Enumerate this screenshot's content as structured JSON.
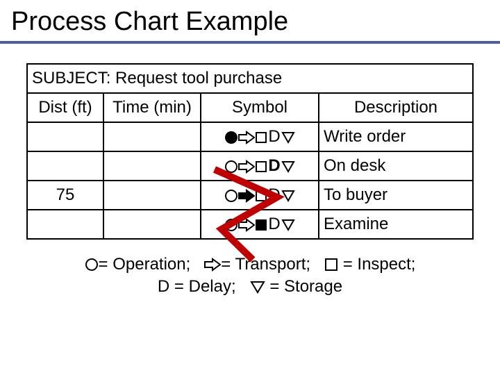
{
  "title": "Process Chart Example",
  "subject_label": "SUBJECT:",
  "subject_value": "Request tool purchase",
  "headers": {
    "dist": "Dist (ft)",
    "time": "Time (min)",
    "symbol": "Symbol",
    "description": "Description"
  },
  "rows": [
    {
      "dist": "",
      "time": "",
      "active": "operation",
      "description": "Write order"
    },
    {
      "dist": "",
      "time": "",
      "active": "delay",
      "description": "On desk"
    },
    {
      "dist": "75",
      "time": "",
      "active": "transport",
      "description": "To buyer"
    },
    {
      "dist": "",
      "time": "",
      "active": "inspect",
      "description": "Examine"
    }
  ],
  "legend": {
    "operation": "= Operation;",
    "transport": "= Transport;",
    "inspect": "= Inspect;",
    "delay_pre": "D",
    "delay": "= Delay;",
    "storage": "= Storage"
  },
  "chart_data": {
    "type": "table",
    "title": "Process Chart Example",
    "subject": "Request tool purchase",
    "columns": [
      "Dist (ft)",
      "Time (min)",
      "Symbol",
      "Description"
    ],
    "symbol_legend": {
      "operation": "circle",
      "transport": "right-arrow",
      "inspect": "square",
      "delay": "D",
      "storage": "inverted-triangle"
    },
    "rows": [
      {
        "dist_ft": null,
        "time_min": null,
        "active_symbol": "operation",
        "description": "Write order"
      },
      {
        "dist_ft": null,
        "time_min": null,
        "active_symbol": "delay",
        "description": "On desk"
      },
      {
        "dist_ft": 75,
        "time_min": null,
        "active_symbol": "transport",
        "description": "To buyer"
      },
      {
        "dist_ft": null,
        "time_min": null,
        "active_symbol": "inspect",
        "description": "Examine"
      }
    ]
  }
}
